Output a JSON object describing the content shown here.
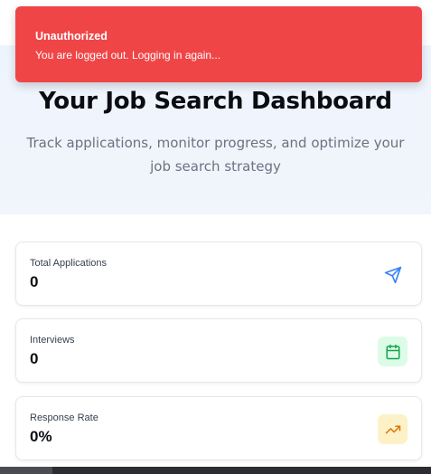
{
  "toast": {
    "title": "Unauthorized",
    "message": "You are logged out. Logging in again...",
    "color": "#f04547"
  },
  "hero": {
    "title": "Your Job Search Dashboard",
    "subtitle": "Track applications, monitor progress, and optimize your job search strategy"
  },
  "stats": [
    {
      "label": "Total Applications",
      "value": "0",
      "icon": "send-icon",
      "icon_color": "#3b82f6",
      "icon_bg": "transparent"
    },
    {
      "label": "Interviews",
      "value": "0",
      "icon": "calendar-icon",
      "icon_color": "#16a34a",
      "icon_bg": "#dcfce7"
    },
    {
      "label": "Response Rate",
      "value": "0%",
      "icon": "trending-up-icon",
      "icon_color": "#d97706",
      "icon_bg": "#fdf1c8"
    }
  ]
}
